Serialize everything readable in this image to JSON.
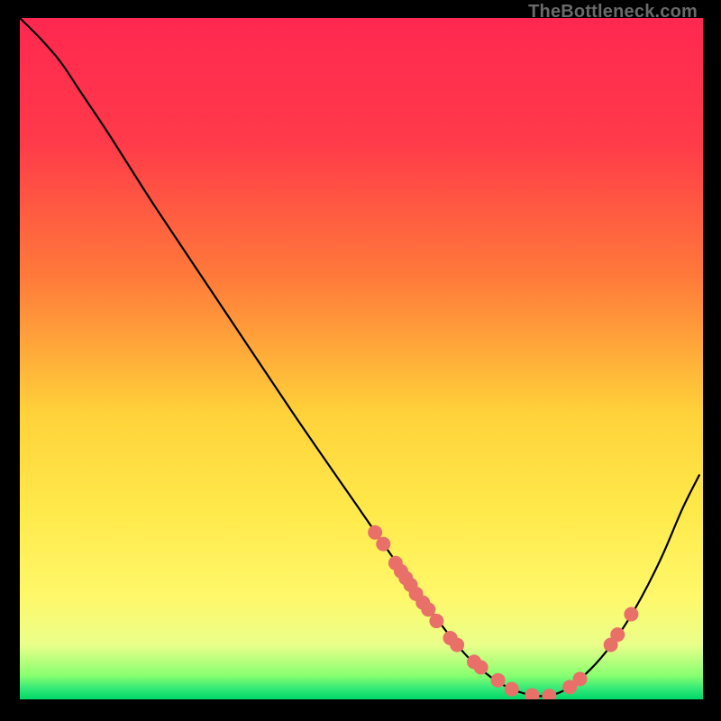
{
  "watermark": "TheBottleneck.com",
  "chart_data": {
    "type": "line",
    "title": "",
    "xlabel": "",
    "ylabel": "",
    "xlim": [
      0,
      100
    ],
    "ylim": [
      0,
      100
    ],
    "gradient_stops": [
      {
        "offset": 0.0,
        "color": "#ff2850"
      },
      {
        "offset": 0.18,
        "color": "#ff3a4a"
      },
      {
        "offset": 0.38,
        "color": "#ff7a3a"
      },
      {
        "offset": 0.58,
        "color": "#ffd23a"
      },
      {
        "offset": 0.72,
        "color": "#ffe94a"
      },
      {
        "offset": 0.85,
        "color": "#fff86a"
      },
      {
        "offset": 0.92,
        "color": "#eaff8a"
      },
      {
        "offset": 0.965,
        "color": "#88ff70"
      },
      {
        "offset": 0.985,
        "color": "#30e878"
      },
      {
        "offset": 1.0,
        "color": "#00d868"
      }
    ],
    "series": [
      {
        "name": "curve",
        "x": [
          0.0,
          3.0,
          6.0,
          9.0,
          13.0,
          20.0,
          30.0,
          40.0,
          50.0,
          58.0,
          64.0,
          68.0,
          72.0,
          76.0,
          79.0,
          82.0,
          85.0,
          88.0,
          91.0,
          94.0,
          97.0,
          99.5
        ],
        "y": [
          100.0,
          97.0,
          93.5,
          89.0,
          83.0,
          72.0,
          57.0,
          42.0,
          27.5,
          16.0,
          8.0,
          4.0,
          1.5,
          0.5,
          1.0,
          3.0,
          6.0,
          10.0,
          15.0,
          21.0,
          28.0,
          33.0
        ]
      }
    ],
    "markers": {
      "name": "points",
      "color": "#e97068",
      "radius": 8,
      "x": [
        52.0,
        53.2,
        55.0,
        55.8,
        56.5,
        57.2,
        58.0,
        59.0,
        59.8,
        61.0,
        63.0,
        64.0,
        66.5,
        67.5,
        70.0,
        72.0,
        75.0,
        77.5,
        80.5,
        82.0,
        86.5,
        87.5,
        89.5
      ],
      "y": [
        24.5,
        22.8,
        20.0,
        18.8,
        17.8,
        16.8,
        15.5,
        14.2,
        13.2,
        11.5,
        9.0,
        8.0,
        5.5,
        4.7,
        2.8,
        1.5,
        0.6,
        0.5,
        1.8,
        3.0,
        8.0,
        9.5,
        12.5
      ]
    }
  }
}
